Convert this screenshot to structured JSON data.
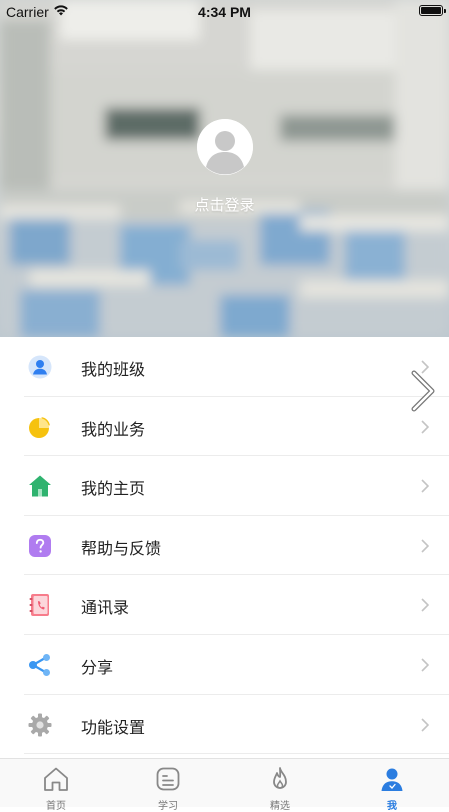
{
  "status_bar": {
    "carrier": "Carrier",
    "time": "4:34 PM"
  },
  "profile": {
    "login_prompt": "点击登录"
  },
  "menu": {
    "items": [
      {
        "label": "我的班级",
        "icon": "user-circle-icon",
        "color": "#2f7ff0"
      },
      {
        "label": "我的业务",
        "icon": "pie-chart-icon",
        "color": "#f6c20f"
      },
      {
        "label": "我的主页",
        "icon": "home-icon",
        "color": "#2fb36f"
      },
      {
        "label": "帮助与反馈",
        "icon": "help-question-icon",
        "color": "#b07cf0"
      },
      {
        "label": "通讯录",
        "icon": "address-book-icon",
        "color": "#f77c8b"
      },
      {
        "label": "分享",
        "icon": "share-icon",
        "color": "#3a97f2"
      },
      {
        "label": "功能设置",
        "icon": "gear-icon",
        "color": "#9a9a9a"
      }
    ]
  },
  "tabbar": {
    "tabs": [
      {
        "label": "首页",
        "icon": "home-outline-icon",
        "active": false
      },
      {
        "label": "学习",
        "icon": "study-icon",
        "active": false
      },
      {
        "label": "精选",
        "icon": "flame-icon",
        "active": false
      },
      {
        "label": "我",
        "icon": "person-icon",
        "active": true
      }
    ],
    "accent_color": "#2b7de0"
  }
}
